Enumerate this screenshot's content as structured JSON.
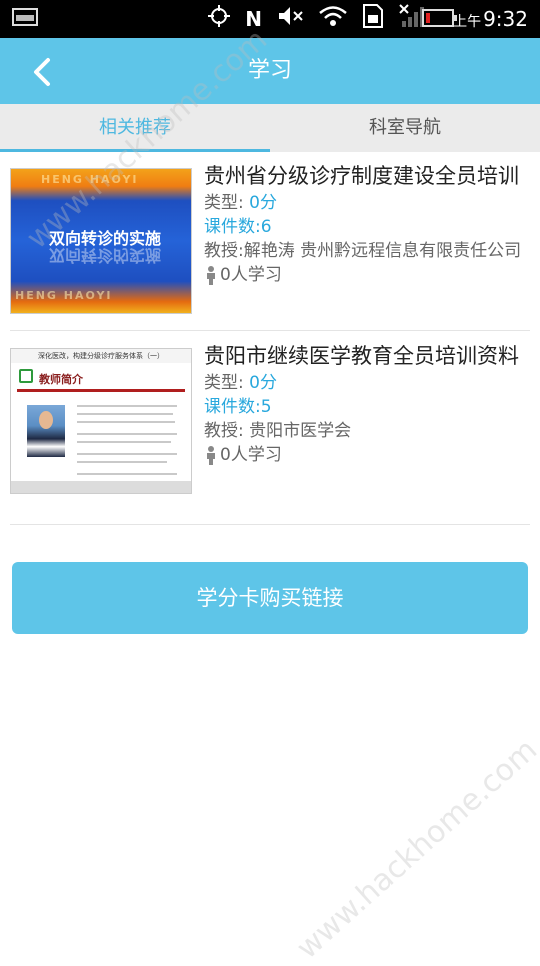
{
  "status_bar": {
    "time_prefix": "上午",
    "time": "9:32",
    "icons": [
      "gallery-icon",
      "crosshair-icon",
      "nfc-icon",
      "mute-icon",
      "wifi-icon",
      "sim-icon",
      "no-signal-icon",
      "battery-icon"
    ],
    "battery_level": 0.15
  },
  "header": {
    "title": "学习",
    "back_icon": "chevron-left-icon"
  },
  "tabs": [
    {
      "label": "相关推荐",
      "active": true
    },
    {
      "label": "科室导航",
      "active": false
    }
  ],
  "courses": [
    {
      "title": "贵州省分级诊疗制度建设全员培训",
      "type_label": "类型:",
      "type_value": "0分",
      "lessons": "课件数:6",
      "professor": "教授:解艳涛  贵州黔远程信息有限责任公司",
      "students": "0人学习",
      "thumbnail": {
        "text": "双向转诊的实施",
        "brand": "HENG HAOYI"
      }
    },
    {
      "title": "贵阳市继续医学教育全员培训资料",
      "type_label": "类型:",
      "type_value": "0分",
      "lessons": "课件数:5",
      "professor": "教授: 贵阳市医学会",
      "students": "0人学习",
      "thumbnail": {
        "header": "深化医改，构建分级诊疗服务体系（一）",
        "section": "教师简介"
      }
    }
  ],
  "buy_button": "学分卡购买链接",
  "watermark": "www.hackhome.com",
  "colors": {
    "accent": "#5ec5e8",
    "tab_active": "#4eb8e0",
    "value_blue": "#29a8dd"
  }
}
